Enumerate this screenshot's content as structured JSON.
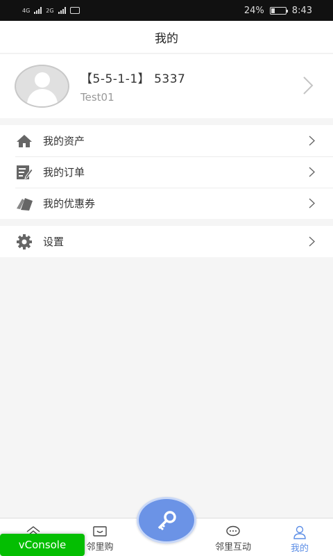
{
  "status_bar": {
    "left_text": "4G 2G",
    "battery_percent": "24%",
    "battery_level": 0.24,
    "time": "8:43"
  },
  "header": {
    "title": "我的"
  },
  "profile": {
    "title": "【5-5-1-1】 5337",
    "subtitle": "Test01",
    "avatar_icon": "user-avatar-icon",
    "arrow_icon": "chevron-right-icon"
  },
  "menu": {
    "group1": [
      {
        "label": "我的资产",
        "icon": "home-icon"
      },
      {
        "label": "我的订单",
        "icon": "edit-document-icon"
      },
      {
        "label": "我的优惠券",
        "icon": "coupon-tag-icon"
      }
    ],
    "group2": [
      {
        "label": "设置",
        "icon": "gear-icon"
      }
    ]
  },
  "bottom_nav": {
    "items": [
      {
        "label": "",
        "icon": "home-outline-icon"
      },
      {
        "label": "邻里购",
        "icon": "shop-icon"
      },
      {
        "label": "邻里互动",
        "icon": "chat-bubble-icon"
      },
      {
        "label": "我的",
        "icon": "person-icon",
        "active": true
      }
    ],
    "center_icon": "key-icon"
  },
  "vconsole": {
    "label": "vConsole"
  },
  "colors": {
    "accent": "#5b8de6",
    "center_button": "#6b93e6",
    "vconsole": "#04be02",
    "background": "#f5f5f5"
  }
}
